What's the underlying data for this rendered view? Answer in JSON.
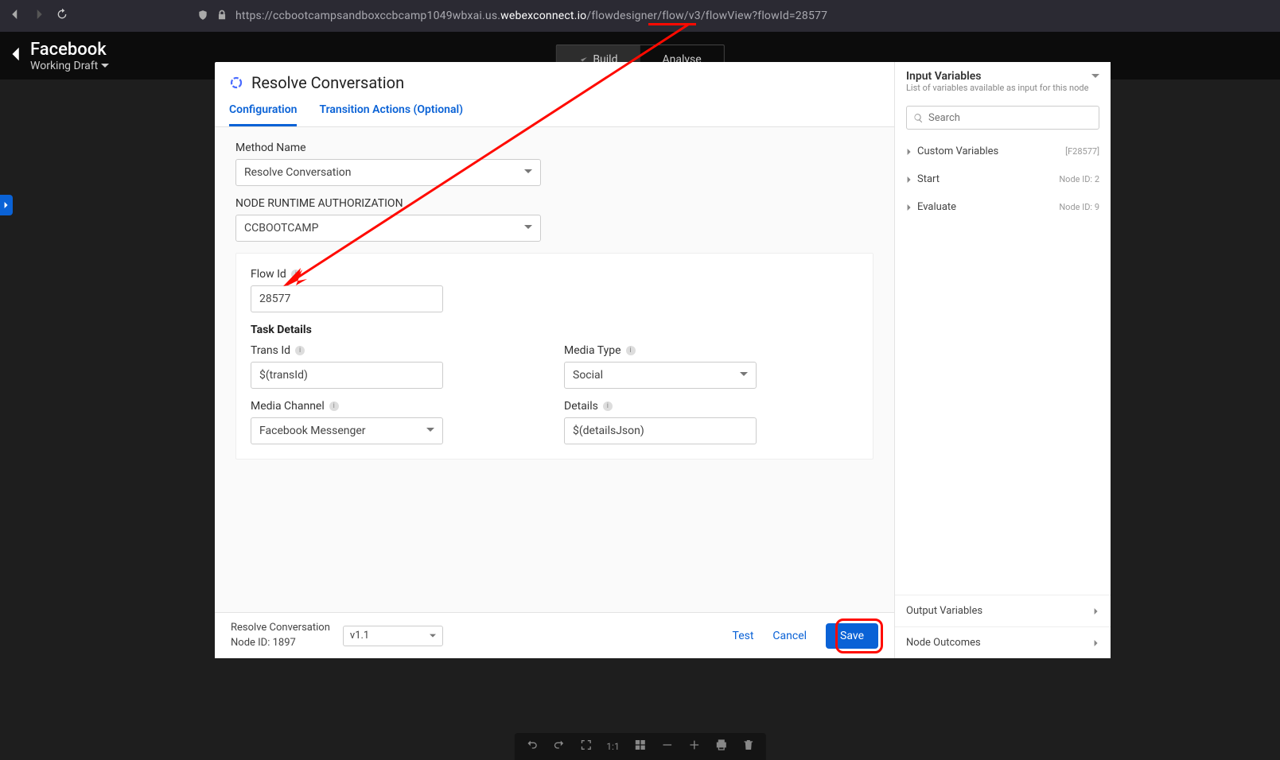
{
  "browser": {
    "url_pre": "https://ccbootcampsandboxccbcamp1049wbxai.us.",
    "url_bold": "webexconnect.io",
    "url_post": "/flowdesigner/flow/v3/flowView?flowId=28577"
  },
  "header": {
    "title": "Facebook",
    "subtitle": "Working Draft",
    "build": "Build",
    "analyse": "Analyse"
  },
  "modal": {
    "title": "Resolve Conversation",
    "tabs": {
      "config": "Configuration",
      "trans": "Transition Actions (Optional)"
    },
    "method_label": "Method Name",
    "method_value": "Resolve Conversation",
    "auth_label": "NODE RUNTIME AUTHORIZATION",
    "auth_value": "CCBOOTCAMP",
    "flowid_label": "Flow Id",
    "flowid_value": "28577",
    "task_title": "Task Details",
    "transid_label": "Trans Id",
    "transid_value": "$(transId)",
    "mediatype_label": "Media Type",
    "mediatype_value": "Social",
    "mediachannel_label": "Media Channel",
    "mediachannel_value": "Facebook Messenger",
    "details_label": "Details",
    "details_value": "$(detailsJson)"
  },
  "footer": {
    "name": "Resolve Conversation",
    "nodeid": "Node ID: 1897",
    "version": "v1.1",
    "test": "Test",
    "cancel": "Cancel",
    "save": "Save"
  },
  "side": {
    "title": "Input Variables",
    "sub": "List of variables available as input for this node",
    "search_ph": "Search",
    "rows": [
      {
        "label": "Custom Variables",
        "meta": "[F28577]"
      },
      {
        "label": "Start",
        "meta": "Node ID: 2"
      },
      {
        "label": "Evaluate",
        "meta": "Node ID: 9"
      }
    ],
    "out": "Output Variables",
    "outcomes": "Node Outcomes"
  },
  "bottom_ratio": "1:1"
}
